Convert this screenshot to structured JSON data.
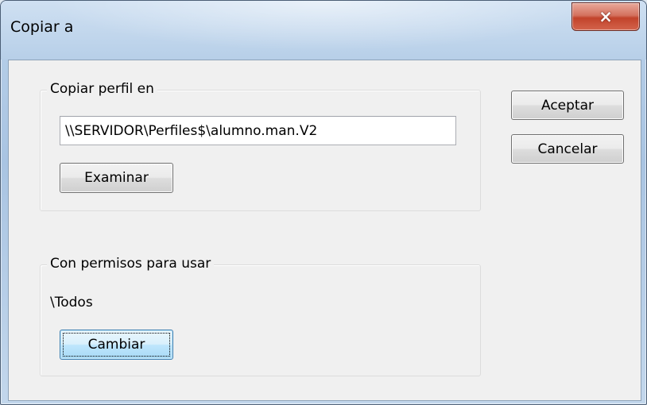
{
  "window": {
    "title": "Copiar a",
    "close_icon": "×"
  },
  "copy_group": {
    "legend": "Copiar perfil en",
    "path_value": "\\\\SERVIDOR\\Perfiles$\\alumno.man.V2",
    "browse_label": "Examinar"
  },
  "permissions_group": {
    "legend": "Con permisos para usar",
    "user": "\\Todos",
    "change_label": "Cambiar"
  },
  "actions": {
    "ok_label": "Aceptar",
    "cancel_label": "Cancelar"
  }
}
